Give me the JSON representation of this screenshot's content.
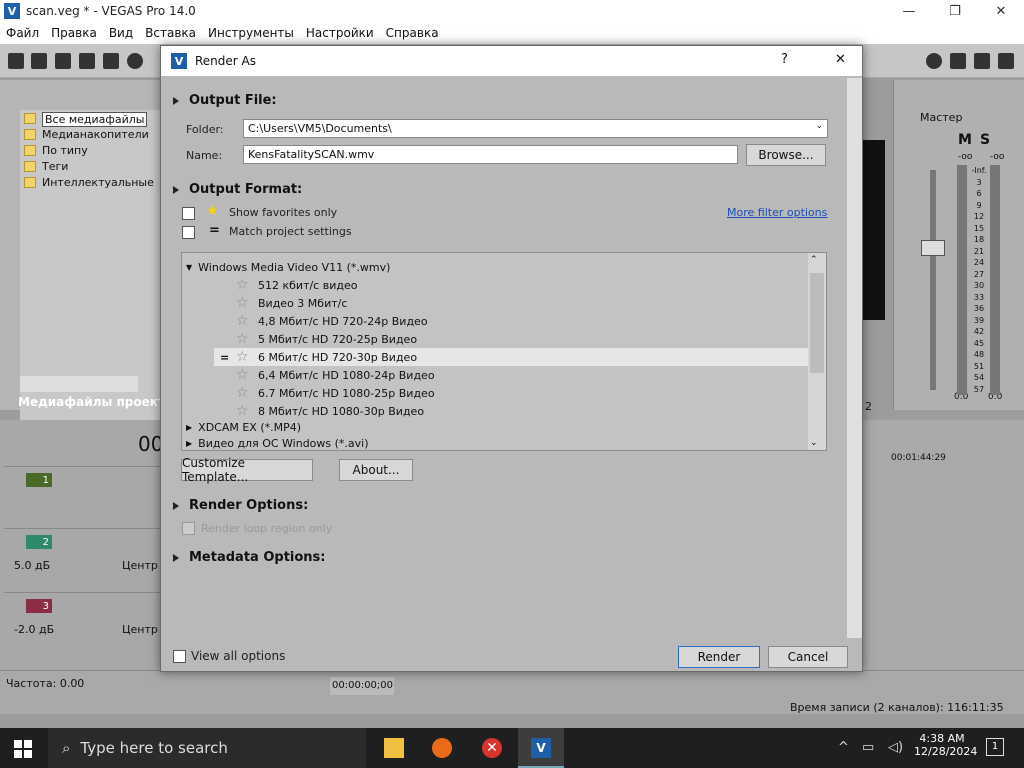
{
  "app": {
    "title": "scan.veg * - VEGAS Pro 14.0",
    "logo_letter": "V"
  },
  "menu": [
    "Файл",
    "Правка",
    "Вид",
    "Вставка",
    "Инструменты",
    "Настройки",
    "Справка"
  ],
  "explorer": {
    "items": [
      "Все медиафайлы",
      "Медианакопители",
      "По типу",
      "Теги",
      "Интеллектуальные"
    ],
    "footer": "Медиафайлы проекта"
  },
  "timeline": {
    "time_partial": "00",
    "tracks": [
      {
        "num": "1",
        "color": "#4a6a2a"
      },
      {
        "num": "2",
        "color": "#2d8a6a",
        "vol": "5.0 дБ",
        "pan": "Центр"
      },
      {
        "num": "3",
        "color": "#8a2d45",
        "vol": "-2.0 дБ",
        "pan": "Центр"
      }
    ],
    "ruler_time": "00:01:44:29",
    "preview_partial": "2"
  },
  "master": {
    "title": "Мастер",
    "m": "M",
    "s": "S",
    "scale": [
      "-Inf.",
      "3",
      "6",
      "9",
      "12",
      "15",
      "18",
      "21",
      "24",
      "27",
      "30",
      "33",
      "36",
      "39",
      "42",
      "45",
      "48",
      "51",
      "54",
      "57"
    ],
    "left_val": "0.0",
    "right_val": "0.0",
    "top_left": "-oo",
    "top_right": "-oo"
  },
  "status": {
    "rate": "Частота: 0.00",
    "time1": "00:00:00;00",
    "record": "Время записи (2 каналов): 116:11:35"
  },
  "taskbar": {
    "search_placeholder": "Type here to search",
    "time": "4:38 AM",
    "date": "12/28/2024",
    "notif": "1"
  },
  "dialog": {
    "title": "Render As",
    "help": "?",
    "close": "✕",
    "output_file": "Output File:",
    "folder_label": "Folder:",
    "folder_value": "C:\\Users\\VM5\\Documents\\",
    "name_label": "Name:",
    "name_value": "KensFatalitySCAN.wmv",
    "browse": "Browse...",
    "output_format": "Output Format:",
    "show_favorites": "Show favorites only",
    "match_project": "Match project settings",
    "more_filter": "More filter options",
    "format_list": {
      "group_open": "Windows Media Video V11 (*.wmv)",
      "templates": [
        "512 кбит/с видео",
        "Видео 3 Мбит/с",
        "4,8 Мбит/с HD 720-24p Видео",
        "5 Мбит/с HD 720-25p Видео",
        "6 Мбит/с HD 720-30p Видео",
        "6,4 Мбит/с HD 1080-24p Видео",
        "6.7 Мбит/с HD 1080-25p Видео",
        "8 Мбит/с HD 1080-30p Видео"
      ],
      "selected_index": 4,
      "groups_closed": [
        "XDCAM EX (*.MP4)",
        "Видео для ОС Windows (*.avi)"
      ]
    },
    "customize": "Customize Template...",
    "about": "About...",
    "render_options": "Render Options:",
    "render_loop": "Render loop region only",
    "metadata_options": "Metadata Options:",
    "view_all": "View all options",
    "render_btn": "Render",
    "cancel_btn": "Cancel"
  }
}
